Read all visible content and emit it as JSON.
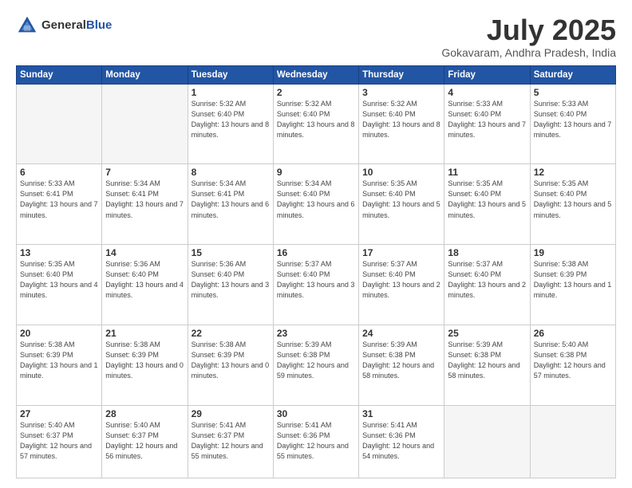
{
  "header": {
    "logo_general": "General",
    "logo_blue": "Blue",
    "month": "July 2025",
    "location": "Gokavaram, Andhra Pradesh, India"
  },
  "weekdays": [
    "Sunday",
    "Monday",
    "Tuesday",
    "Wednesday",
    "Thursday",
    "Friday",
    "Saturday"
  ],
  "weeks": [
    [
      {
        "day": "",
        "info": ""
      },
      {
        "day": "",
        "info": ""
      },
      {
        "day": "1",
        "info": "Sunrise: 5:32 AM\nSunset: 6:40 PM\nDaylight: 13 hours and 8 minutes."
      },
      {
        "day": "2",
        "info": "Sunrise: 5:32 AM\nSunset: 6:40 PM\nDaylight: 13 hours and 8 minutes."
      },
      {
        "day": "3",
        "info": "Sunrise: 5:32 AM\nSunset: 6:40 PM\nDaylight: 13 hours and 8 minutes."
      },
      {
        "day": "4",
        "info": "Sunrise: 5:33 AM\nSunset: 6:40 PM\nDaylight: 13 hours and 7 minutes."
      },
      {
        "day": "5",
        "info": "Sunrise: 5:33 AM\nSunset: 6:40 PM\nDaylight: 13 hours and 7 minutes."
      }
    ],
    [
      {
        "day": "6",
        "info": "Sunrise: 5:33 AM\nSunset: 6:41 PM\nDaylight: 13 hours and 7 minutes."
      },
      {
        "day": "7",
        "info": "Sunrise: 5:34 AM\nSunset: 6:41 PM\nDaylight: 13 hours and 7 minutes."
      },
      {
        "day": "8",
        "info": "Sunrise: 5:34 AM\nSunset: 6:41 PM\nDaylight: 13 hours and 6 minutes."
      },
      {
        "day": "9",
        "info": "Sunrise: 5:34 AM\nSunset: 6:40 PM\nDaylight: 13 hours and 6 minutes."
      },
      {
        "day": "10",
        "info": "Sunrise: 5:35 AM\nSunset: 6:40 PM\nDaylight: 13 hours and 5 minutes."
      },
      {
        "day": "11",
        "info": "Sunrise: 5:35 AM\nSunset: 6:40 PM\nDaylight: 13 hours and 5 minutes."
      },
      {
        "day": "12",
        "info": "Sunrise: 5:35 AM\nSunset: 6:40 PM\nDaylight: 13 hours and 5 minutes."
      }
    ],
    [
      {
        "day": "13",
        "info": "Sunrise: 5:35 AM\nSunset: 6:40 PM\nDaylight: 13 hours and 4 minutes."
      },
      {
        "day": "14",
        "info": "Sunrise: 5:36 AM\nSunset: 6:40 PM\nDaylight: 13 hours and 4 minutes."
      },
      {
        "day": "15",
        "info": "Sunrise: 5:36 AM\nSunset: 6:40 PM\nDaylight: 13 hours and 3 minutes."
      },
      {
        "day": "16",
        "info": "Sunrise: 5:37 AM\nSunset: 6:40 PM\nDaylight: 13 hours and 3 minutes."
      },
      {
        "day": "17",
        "info": "Sunrise: 5:37 AM\nSunset: 6:40 PM\nDaylight: 13 hours and 2 minutes."
      },
      {
        "day": "18",
        "info": "Sunrise: 5:37 AM\nSunset: 6:40 PM\nDaylight: 13 hours and 2 minutes."
      },
      {
        "day": "19",
        "info": "Sunrise: 5:38 AM\nSunset: 6:39 PM\nDaylight: 13 hours and 1 minute."
      }
    ],
    [
      {
        "day": "20",
        "info": "Sunrise: 5:38 AM\nSunset: 6:39 PM\nDaylight: 13 hours and 1 minute."
      },
      {
        "day": "21",
        "info": "Sunrise: 5:38 AM\nSunset: 6:39 PM\nDaylight: 13 hours and 0 minutes."
      },
      {
        "day": "22",
        "info": "Sunrise: 5:38 AM\nSunset: 6:39 PM\nDaylight: 13 hours and 0 minutes."
      },
      {
        "day": "23",
        "info": "Sunrise: 5:39 AM\nSunset: 6:38 PM\nDaylight: 12 hours and 59 minutes."
      },
      {
        "day": "24",
        "info": "Sunrise: 5:39 AM\nSunset: 6:38 PM\nDaylight: 12 hours and 58 minutes."
      },
      {
        "day": "25",
        "info": "Sunrise: 5:39 AM\nSunset: 6:38 PM\nDaylight: 12 hours and 58 minutes."
      },
      {
        "day": "26",
        "info": "Sunrise: 5:40 AM\nSunset: 6:38 PM\nDaylight: 12 hours and 57 minutes."
      }
    ],
    [
      {
        "day": "27",
        "info": "Sunrise: 5:40 AM\nSunset: 6:37 PM\nDaylight: 12 hours and 57 minutes."
      },
      {
        "day": "28",
        "info": "Sunrise: 5:40 AM\nSunset: 6:37 PM\nDaylight: 12 hours and 56 minutes."
      },
      {
        "day": "29",
        "info": "Sunrise: 5:41 AM\nSunset: 6:37 PM\nDaylight: 12 hours and 55 minutes."
      },
      {
        "day": "30",
        "info": "Sunrise: 5:41 AM\nSunset: 6:36 PM\nDaylight: 12 hours and 55 minutes."
      },
      {
        "day": "31",
        "info": "Sunrise: 5:41 AM\nSunset: 6:36 PM\nDaylight: 12 hours and 54 minutes."
      },
      {
        "day": "",
        "info": ""
      },
      {
        "day": "",
        "info": ""
      }
    ]
  ]
}
